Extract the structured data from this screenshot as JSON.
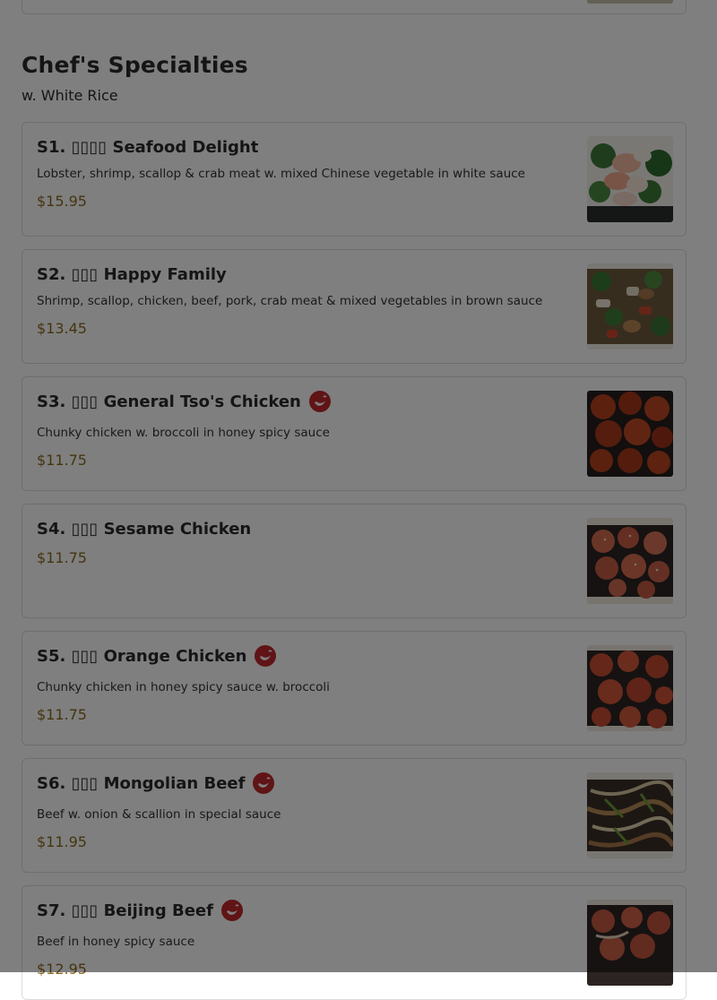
{
  "section": {
    "title": "Chef's Specialties",
    "subtitle": "w. White Rice"
  },
  "items": [
    {
      "title": "S1. ▯▯▯▯ Seafood Delight",
      "description": "Lobster, shrimp, scallop & crab meat w. mixed Chinese vegetable in white sauce",
      "price": "$15.95",
      "spicy": false,
      "image": "seafood-delight-photo"
    },
    {
      "title": "S2. ▯▯▯ Happy Family",
      "description": "Shrimp, scallop, chicken, beef, pork, crab meat & mixed vegetables in brown sauce",
      "price": "$13.45",
      "spicy": false,
      "image": "happy-family-photo"
    },
    {
      "title": "S3. ▯▯▯ General Tso's Chicken",
      "description": "Chunky chicken w. broccoli in honey spicy sauce",
      "price": "$11.75",
      "spicy": true,
      "image": "general-tsos-chicken-photo"
    },
    {
      "title": "S4. ▯▯▯ Sesame Chicken",
      "description": "",
      "price": "$11.75",
      "spicy": false,
      "image": "sesame-chicken-photo"
    },
    {
      "title": "S5. ▯▯▯ Orange Chicken",
      "description": "Chunky chicken in honey spicy sauce w. broccoli",
      "price": "$11.75",
      "spicy": true,
      "image": "orange-chicken-photo"
    },
    {
      "title": "S6. ▯▯▯ Mongolian Beef",
      "description": "Beef w. onion & scallion in special sauce",
      "price": "$11.95",
      "spicy": true,
      "image": "mongolian-beef-photo"
    },
    {
      "title": "S7. ▯▯▯ Beijing Beef",
      "description": "Beef in honey spicy sauce",
      "price": "$12.95",
      "spicy": true,
      "image": "beijing-beef-photo"
    }
  ],
  "icons": {
    "spicy": "chili-pepper-icon"
  },
  "colors": {
    "spicy_icon": "#c0282d",
    "price": "#8a6a1e",
    "overlay": "rgba(0,0,0,0.5)"
  }
}
